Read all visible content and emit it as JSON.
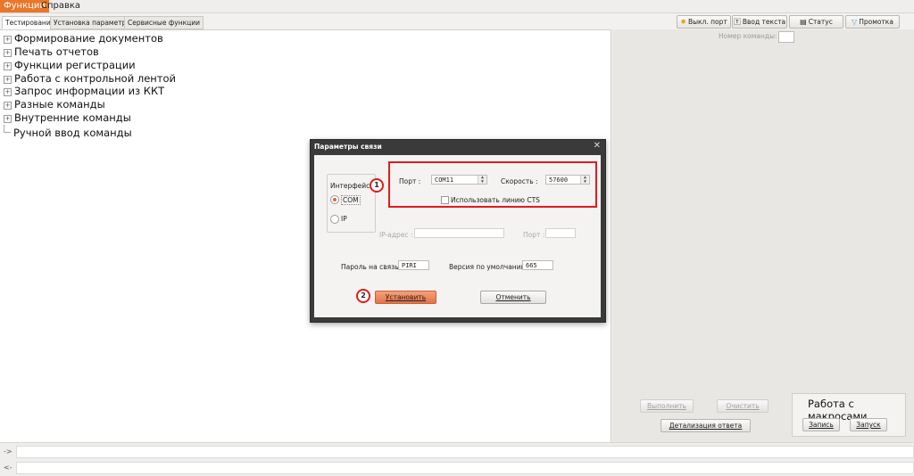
{
  "menubar": {
    "functions": "Функции",
    "help": "Справка"
  },
  "tabs": [
    "Тестирование",
    "Установка параметров",
    "Сервисные функции"
  ],
  "toolbar": {
    "port_off": "Выкл. порт",
    "text_input": "Ввод текста",
    "status": "Статус",
    "feed": "Промотка"
  },
  "tree": [
    {
      "label": "Формирование документов",
      "expandable": true
    },
    {
      "label": "Печать отчетов",
      "expandable": true
    },
    {
      "label": "Функции регистрации",
      "expandable": true
    },
    {
      "label": "Работа с контрольной лентой",
      "expandable": true
    },
    {
      "label": "Запрос информации из ККТ",
      "expandable": true
    },
    {
      "label": "Разные команды",
      "expandable": true
    },
    {
      "label": "Внутренние команды",
      "expandable": true
    },
    {
      "label": "Ручной ввод команды",
      "expandable": false
    }
  ],
  "right_panel": {
    "command_number_label": "Номер команды:",
    "command_number_value": "",
    "execute": "Выполнить",
    "clear": "Очистить",
    "response_details": "Детализация ответа",
    "macros_title": "Работа с макросами",
    "record": "Запись",
    "run": "Запуск"
  },
  "bottom": {
    "out_prefix": "->",
    "in_prefix": "<-",
    "out_value": "",
    "in_value": ""
  },
  "dialog": {
    "title": "Параметры связи",
    "interface_label": "Интерфейс :",
    "com_label": "COM",
    "ip_label": "IP",
    "selected_interface": "COM",
    "port_label": "Порт :",
    "port_value": "COM11",
    "speed_label": "Скорость :",
    "speed_value": "57600",
    "cts_label": "Использовать линию CTS",
    "cts_checked": false,
    "ip_address_label": "IP-адрес :",
    "ip_address_value": "",
    "ip_port_label": "Порт :",
    "ip_port_value": "",
    "password_label": "Пароль на связь :",
    "password_value": "PIRI",
    "default_version_label": "Версия по умолчанию :",
    "default_version_value": "665",
    "install_button": "Установить",
    "cancel_button": "Отменить",
    "marker_1": "1",
    "marker_2": "2"
  },
  "colors": {
    "accent": "#e8772b",
    "highlight_red": "#e21b1b",
    "primary_button": "#e57346"
  }
}
